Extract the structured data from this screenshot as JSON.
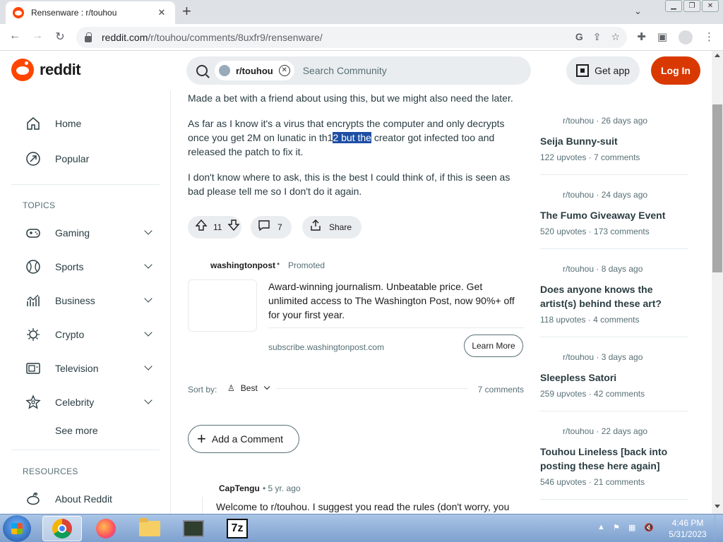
{
  "browser": {
    "tab_title": "Rensenware : r/touhou",
    "tab_close": "✕",
    "newtab": "+",
    "url_host": "reddit.com",
    "url_path": "/r/touhou/comments/8uxfr9/rensenware/"
  },
  "header": {
    "logo_text": "reddit",
    "community_chip": "r/touhou",
    "search_placeholder": "Search Community",
    "get_app": "Get app",
    "login": "Log In",
    "accent": "#d93900"
  },
  "sidebar": {
    "items": [
      {
        "label": "Home"
      },
      {
        "label": "Popular"
      }
    ],
    "topics_title": "TOPICS",
    "topics": [
      {
        "label": "Gaming"
      },
      {
        "label": "Sports"
      },
      {
        "label": "Business"
      },
      {
        "label": "Crypto"
      },
      {
        "label": "Television"
      },
      {
        "label": "Celebrity"
      }
    ],
    "see_more": "See more",
    "resources_title": "RESOURCES",
    "resources": [
      {
        "label": "About Reddit"
      }
    ]
  },
  "post": {
    "line1": "Made a bet with a friend about using this, but we might also need the later.",
    "p2_before": "As far as I know it's a virus that encrypts the computer and only decrypts once you get 2M on lunatic in th1",
    "p2_highlight": "2 but the",
    "p2_after": " creator got infected too and released the patch to fix it.",
    "p3": "I don't know where to ask, this is the best I could think of, if this is seen as bad please tell me so I don't do it again.",
    "votes": "11",
    "comments": "7",
    "share": "Share"
  },
  "ad": {
    "advertiser": "washingtonpost",
    "dot": "•",
    "promoted": "Promoted",
    "text": "Award-winning journalism. Unbeatable price. Get unlimited access to The Washington Post, now 90%+ off for your first year.",
    "domain": "subscribe.washingtonpost.com",
    "cta": "Learn More"
  },
  "sort": {
    "label": "Sort by:",
    "value": "Best",
    "count": "7 comments"
  },
  "add_comment": "Add a Comment",
  "comment": {
    "author": "CapTengu",
    "meta": "•  5 yr. ago",
    "body": "Welcome to r/touhou. I suggest you read the rules (don't worry, you"
  },
  "related": [
    {
      "meta": "r/touhou · 26 days ago",
      "title": "Seija Bunny-suit",
      "stats": "122 upvotes · 7 comments"
    },
    {
      "meta": "r/touhou · 24 days ago",
      "title": "The Fumo Giveaway Event",
      "stats": "520 upvotes · 173 comments"
    },
    {
      "meta": "r/touhou · 8 days ago",
      "title": "Does anyone knows the artist(s) behind these art?",
      "stats": "118 upvotes · 4 comments"
    },
    {
      "meta": "r/touhou · 3 days ago",
      "title": "Sleepless Satori",
      "stats": "259 upvotes · 42 comments"
    },
    {
      "meta": "r/touhou · 22 days ago",
      "title": "Touhou Lineless [back into posting these here again]",
      "stats": "546 upvotes · 21 comments"
    }
  ],
  "taskbar": {
    "time": "4:46 PM",
    "date": "5/31/2023",
    "z7": "7z"
  }
}
